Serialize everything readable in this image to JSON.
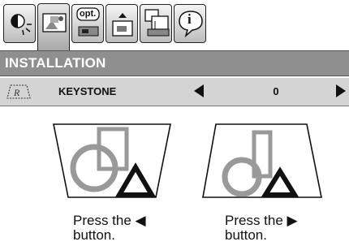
{
  "menu": {
    "tabs": [
      {
        "icon": "brightness-icon"
      },
      {
        "icon": "picture-image-icon"
      },
      {
        "icon": "options-icon",
        "label": "opt."
      },
      {
        "icon": "screen-display-icon"
      },
      {
        "icon": "installation-icon"
      },
      {
        "icon": "info-icon",
        "label": "i"
      }
    ],
    "active_tab": 1
  },
  "section": {
    "title": "INSTALLATION"
  },
  "keystone": {
    "label": "KEYSTONE",
    "value": "0",
    "icon": "keystone-icon"
  },
  "instructions": {
    "left": {
      "line1": "Press the ◀",
      "line2": "button."
    },
    "right": {
      "line1": "Press the ▶",
      "line2": "button."
    }
  }
}
